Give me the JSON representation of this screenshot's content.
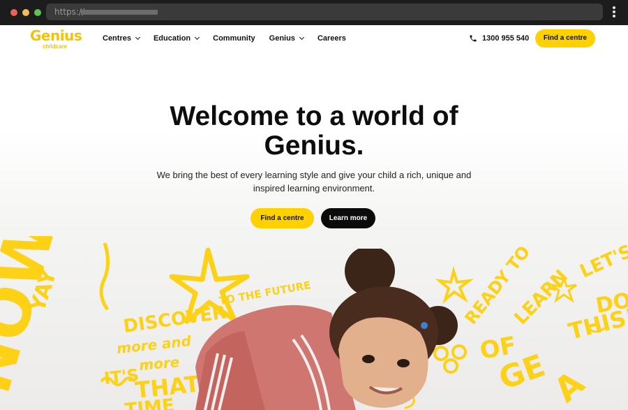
{
  "browser": {
    "url_prefix": "https://"
  },
  "header": {
    "logo": {
      "word": "Genius",
      "sub": "childcare"
    },
    "nav": [
      {
        "label": "Centres",
        "has_dropdown": true
      },
      {
        "label": "Education",
        "has_dropdown": true
      },
      {
        "label": "Community",
        "has_dropdown": false
      },
      {
        "label": "Genius",
        "has_dropdown": true
      },
      {
        "label": "Careers",
        "has_dropdown": false
      }
    ],
    "phone": "1300 955 540",
    "cta_label": "Find a centre"
  },
  "hero": {
    "title_line1": "Welcome to a world of",
    "title_line2": "Genius.",
    "subtitle_line1": "We bring the best of every learning style and give your child a rich, unique and",
    "subtitle_line2": "inspired learning environment.",
    "primary_cta": "Find a centre",
    "secondary_cta": "Learn more"
  },
  "doodles": {
    "left": [
      "YAY",
      "NOW",
      "DISCOVER",
      "more and",
      "more",
      "IT'S",
      "THAT",
      "TIME",
      "TO THE FUTURE"
    ],
    "right": [
      "READY TO",
      "LEARN",
      "LET'S",
      "DO",
      "THIS!",
      "OF",
      "GE",
      "A"
    ]
  },
  "colors": {
    "brand_yellow": "#ffd100",
    "doodle_yellow": "#fcd116",
    "dark": "#0b0b0b"
  }
}
